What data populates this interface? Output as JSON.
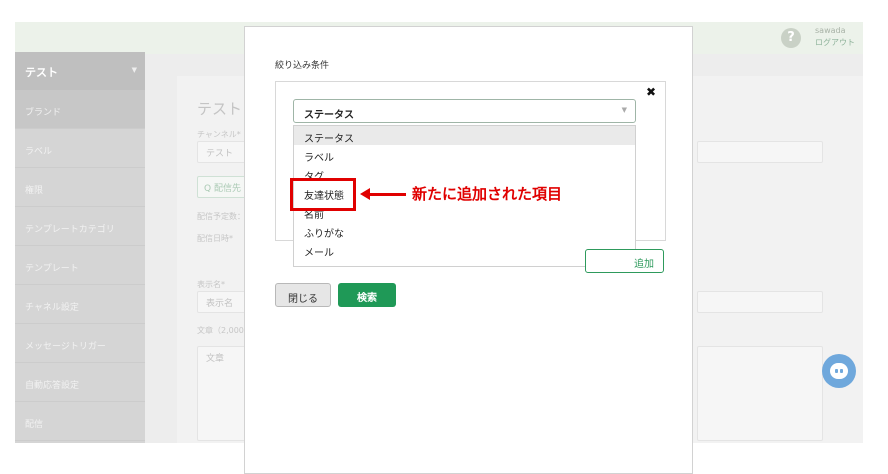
{
  "topbar": {
    "help_symbol": "?",
    "username": "sawada",
    "logout": "ログアウト"
  },
  "sidebar": {
    "header": "テスト",
    "items": [
      {
        "label": "ブランド"
      },
      {
        "label": "ラベル"
      },
      {
        "label": "権限"
      },
      {
        "label": "テンプレートカテゴリ"
      },
      {
        "label": "テンプレート"
      },
      {
        "label": "チャネル設定"
      },
      {
        "label": "メッセージトリガー"
      },
      {
        "label": "自動応答設定"
      },
      {
        "label": "配信"
      }
    ]
  },
  "content": {
    "title": "テスト",
    "channel_label": "チャンネル*",
    "channel_value": "テスト",
    "target_button": "Q 配信先",
    "scheduled_count_label": "配信予定数：",
    "datetime_label": "配信日時*",
    "display_name_label": "表示名*",
    "display_name_placeholder": "表示名",
    "body_label": "文章（2,000",
    "body_placeholder": "文章"
  },
  "modal": {
    "title": "絞り込み条件",
    "close_symbol": "✖",
    "select_value": "ステータス",
    "options": [
      "ステータス",
      "ラベル",
      "タグ",
      "友達状態",
      "名前",
      "ふりがな",
      "メール"
    ],
    "highlighted_option_index": 0,
    "add_button": "追加",
    "close_button": "閉じる",
    "search_button": "検索"
  },
  "annotation": {
    "text": "新たに追加された項目",
    "color": "#e00000"
  },
  "icons": {
    "help": "question-circle-icon",
    "chat": "chat-bubble-icon",
    "dropdown": "chevron-down-icon",
    "close": "close-icon",
    "arrow": "arrow-left-icon"
  },
  "colors": {
    "accent_green": "#1f9957",
    "annotation_red": "#e00000",
    "chat_blue": "#6fa8dc"
  }
}
